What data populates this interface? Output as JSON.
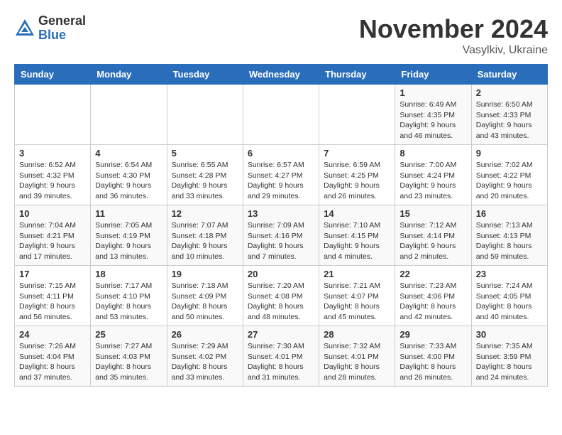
{
  "logo": {
    "general": "General",
    "blue": "Blue"
  },
  "title": "November 2024",
  "location": "Vasylkiv, Ukraine",
  "headers": [
    "Sunday",
    "Monday",
    "Tuesday",
    "Wednesday",
    "Thursday",
    "Friday",
    "Saturday"
  ],
  "weeks": [
    [
      {
        "day": "",
        "sunrise": "",
        "sunset": "",
        "daylight": ""
      },
      {
        "day": "",
        "sunrise": "",
        "sunset": "",
        "daylight": ""
      },
      {
        "day": "",
        "sunrise": "",
        "sunset": "",
        "daylight": ""
      },
      {
        "day": "",
        "sunrise": "",
        "sunset": "",
        "daylight": ""
      },
      {
        "day": "",
        "sunrise": "",
        "sunset": "",
        "daylight": ""
      },
      {
        "day": "1",
        "sunrise": "Sunrise: 6:49 AM",
        "sunset": "Sunset: 4:35 PM",
        "daylight": "Daylight: 9 hours and 46 minutes."
      },
      {
        "day": "2",
        "sunrise": "Sunrise: 6:50 AM",
        "sunset": "Sunset: 4:33 PM",
        "daylight": "Daylight: 9 hours and 43 minutes."
      }
    ],
    [
      {
        "day": "3",
        "sunrise": "Sunrise: 6:52 AM",
        "sunset": "Sunset: 4:32 PM",
        "daylight": "Daylight: 9 hours and 39 minutes."
      },
      {
        "day": "4",
        "sunrise": "Sunrise: 6:54 AM",
        "sunset": "Sunset: 4:30 PM",
        "daylight": "Daylight: 9 hours and 36 minutes."
      },
      {
        "day": "5",
        "sunrise": "Sunrise: 6:55 AM",
        "sunset": "Sunset: 4:28 PM",
        "daylight": "Daylight: 9 hours and 33 minutes."
      },
      {
        "day": "6",
        "sunrise": "Sunrise: 6:57 AM",
        "sunset": "Sunset: 4:27 PM",
        "daylight": "Daylight: 9 hours and 29 minutes."
      },
      {
        "day": "7",
        "sunrise": "Sunrise: 6:59 AM",
        "sunset": "Sunset: 4:25 PM",
        "daylight": "Daylight: 9 hours and 26 minutes."
      },
      {
        "day": "8",
        "sunrise": "Sunrise: 7:00 AM",
        "sunset": "Sunset: 4:24 PM",
        "daylight": "Daylight: 9 hours and 23 minutes."
      },
      {
        "day": "9",
        "sunrise": "Sunrise: 7:02 AM",
        "sunset": "Sunset: 4:22 PM",
        "daylight": "Daylight: 9 hours and 20 minutes."
      }
    ],
    [
      {
        "day": "10",
        "sunrise": "Sunrise: 7:04 AM",
        "sunset": "Sunset: 4:21 PM",
        "daylight": "Daylight: 9 hours and 17 minutes."
      },
      {
        "day": "11",
        "sunrise": "Sunrise: 7:05 AM",
        "sunset": "Sunset: 4:19 PM",
        "daylight": "Daylight: 9 hours and 13 minutes."
      },
      {
        "day": "12",
        "sunrise": "Sunrise: 7:07 AM",
        "sunset": "Sunset: 4:18 PM",
        "daylight": "Daylight: 9 hours and 10 minutes."
      },
      {
        "day": "13",
        "sunrise": "Sunrise: 7:09 AM",
        "sunset": "Sunset: 4:16 PM",
        "daylight": "Daylight: 9 hours and 7 minutes."
      },
      {
        "day": "14",
        "sunrise": "Sunrise: 7:10 AM",
        "sunset": "Sunset: 4:15 PM",
        "daylight": "Daylight: 9 hours and 4 minutes."
      },
      {
        "day": "15",
        "sunrise": "Sunrise: 7:12 AM",
        "sunset": "Sunset: 4:14 PM",
        "daylight": "Daylight: 9 hours and 2 minutes."
      },
      {
        "day": "16",
        "sunrise": "Sunrise: 7:13 AM",
        "sunset": "Sunset: 4:13 PM",
        "daylight": "Daylight: 8 hours and 59 minutes."
      }
    ],
    [
      {
        "day": "17",
        "sunrise": "Sunrise: 7:15 AM",
        "sunset": "Sunset: 4:11 PM",
        "daylight": "Daylight: 8 hours and 56 minutes."
      },
      {
        "day": "18",
        "sunrise": "Sunrise: 7:17 AM",
        "sunset": "Sunset: 4:10 PM",
        "daylight": "Daylight: 8 hours and 53 minutes."
      },
      {
        "day": "19",
        "sunrise": "Sunrise: 7:18 AM",
        "sunset": "Sunset: 4:09 PM",
        "daylight": "Daylight: 8 hours and 50 minutes."
      },
      {
        "day": "20",
        "sunrise": "Sunrise: 7:20 AM",
        "sunset": "Sunset: 4:08 PM",
        "daylight": "Daylight: 8 hours and 48 minutes."
      },
      {
        "day": "21",
        "sunrise": "Sunrise: 7:21 AM",
        "sunset": "Sunset: 4:07 PM",
        "daylight": "Daylight: 8 hours and 45 minutes."
      },
      {
        "day": "22",
        "sunrise": "Sunrise: 7:23 AM",
        "sunset": "Sunset: 4:06 PM",
        "daylight": "Daylight: 8 hours and 42 minutes."
      },
      {
        "day": "23",
        "sunrise": "Sunrise: 7:24 AM",
        "sunset": "Sunset: 4:05 PM",
        "daylight": "Daylight: 8 hours and 40 minutes."
      }
    ],
    [
      {
        "day": "24",
        "sunrise": "Sunrise: 7:26 AM",
        "sunset": "Sunset: 4:04 PM",
        "daylight": "Daylight: 8 hours and 37 minutes."
      },
      {
        "day": "25",
        "sunrise": "Sunrise: 7:27 AM",
        "sunset": "Sunset: 4:03 PM",
        "daylight": "Daylight: 8 hours and 35 minutes."
      },
      {
        "day": "26",
        "sunrise": "Sunrise: 7:29 AM",
        "sunset": "Sunset: 4:02 PM",
        "daylight": "Daylight: 8 hours and 33 minutes."
      },
      {
        "day": "27",
        "sunrise": "Sunrise: 7:30 AM",
        "sunset": "Sunset: 4:01 PM",
        "daylight": "Daylight: 8 hours and 31 minutes."
      },
      {
        "day": "28",
        "sunrise": "Sunrise: 7:32 AM",
        "sunset": "Sunset: 4:01 PM",
        "daylight": "Daylight: 8 hours and 28 minutes."
      },
      {
        "day": "29",
        "sunrise": "Sunrise: 7:33 AM",
        "sunset": "Sunset: 4:00 PM",
        "daylight": "Daylight: 8 hours and 26 minutes."
      },
      {
        "day": "30",
        "sunrise": "Sunrise: 7:35 AM",
        "sunset": "Sunset: 3:59 PM",
        "daylight": "Daylight: 8 hours and 24 minutes."
      }
    ]
  ]
}
